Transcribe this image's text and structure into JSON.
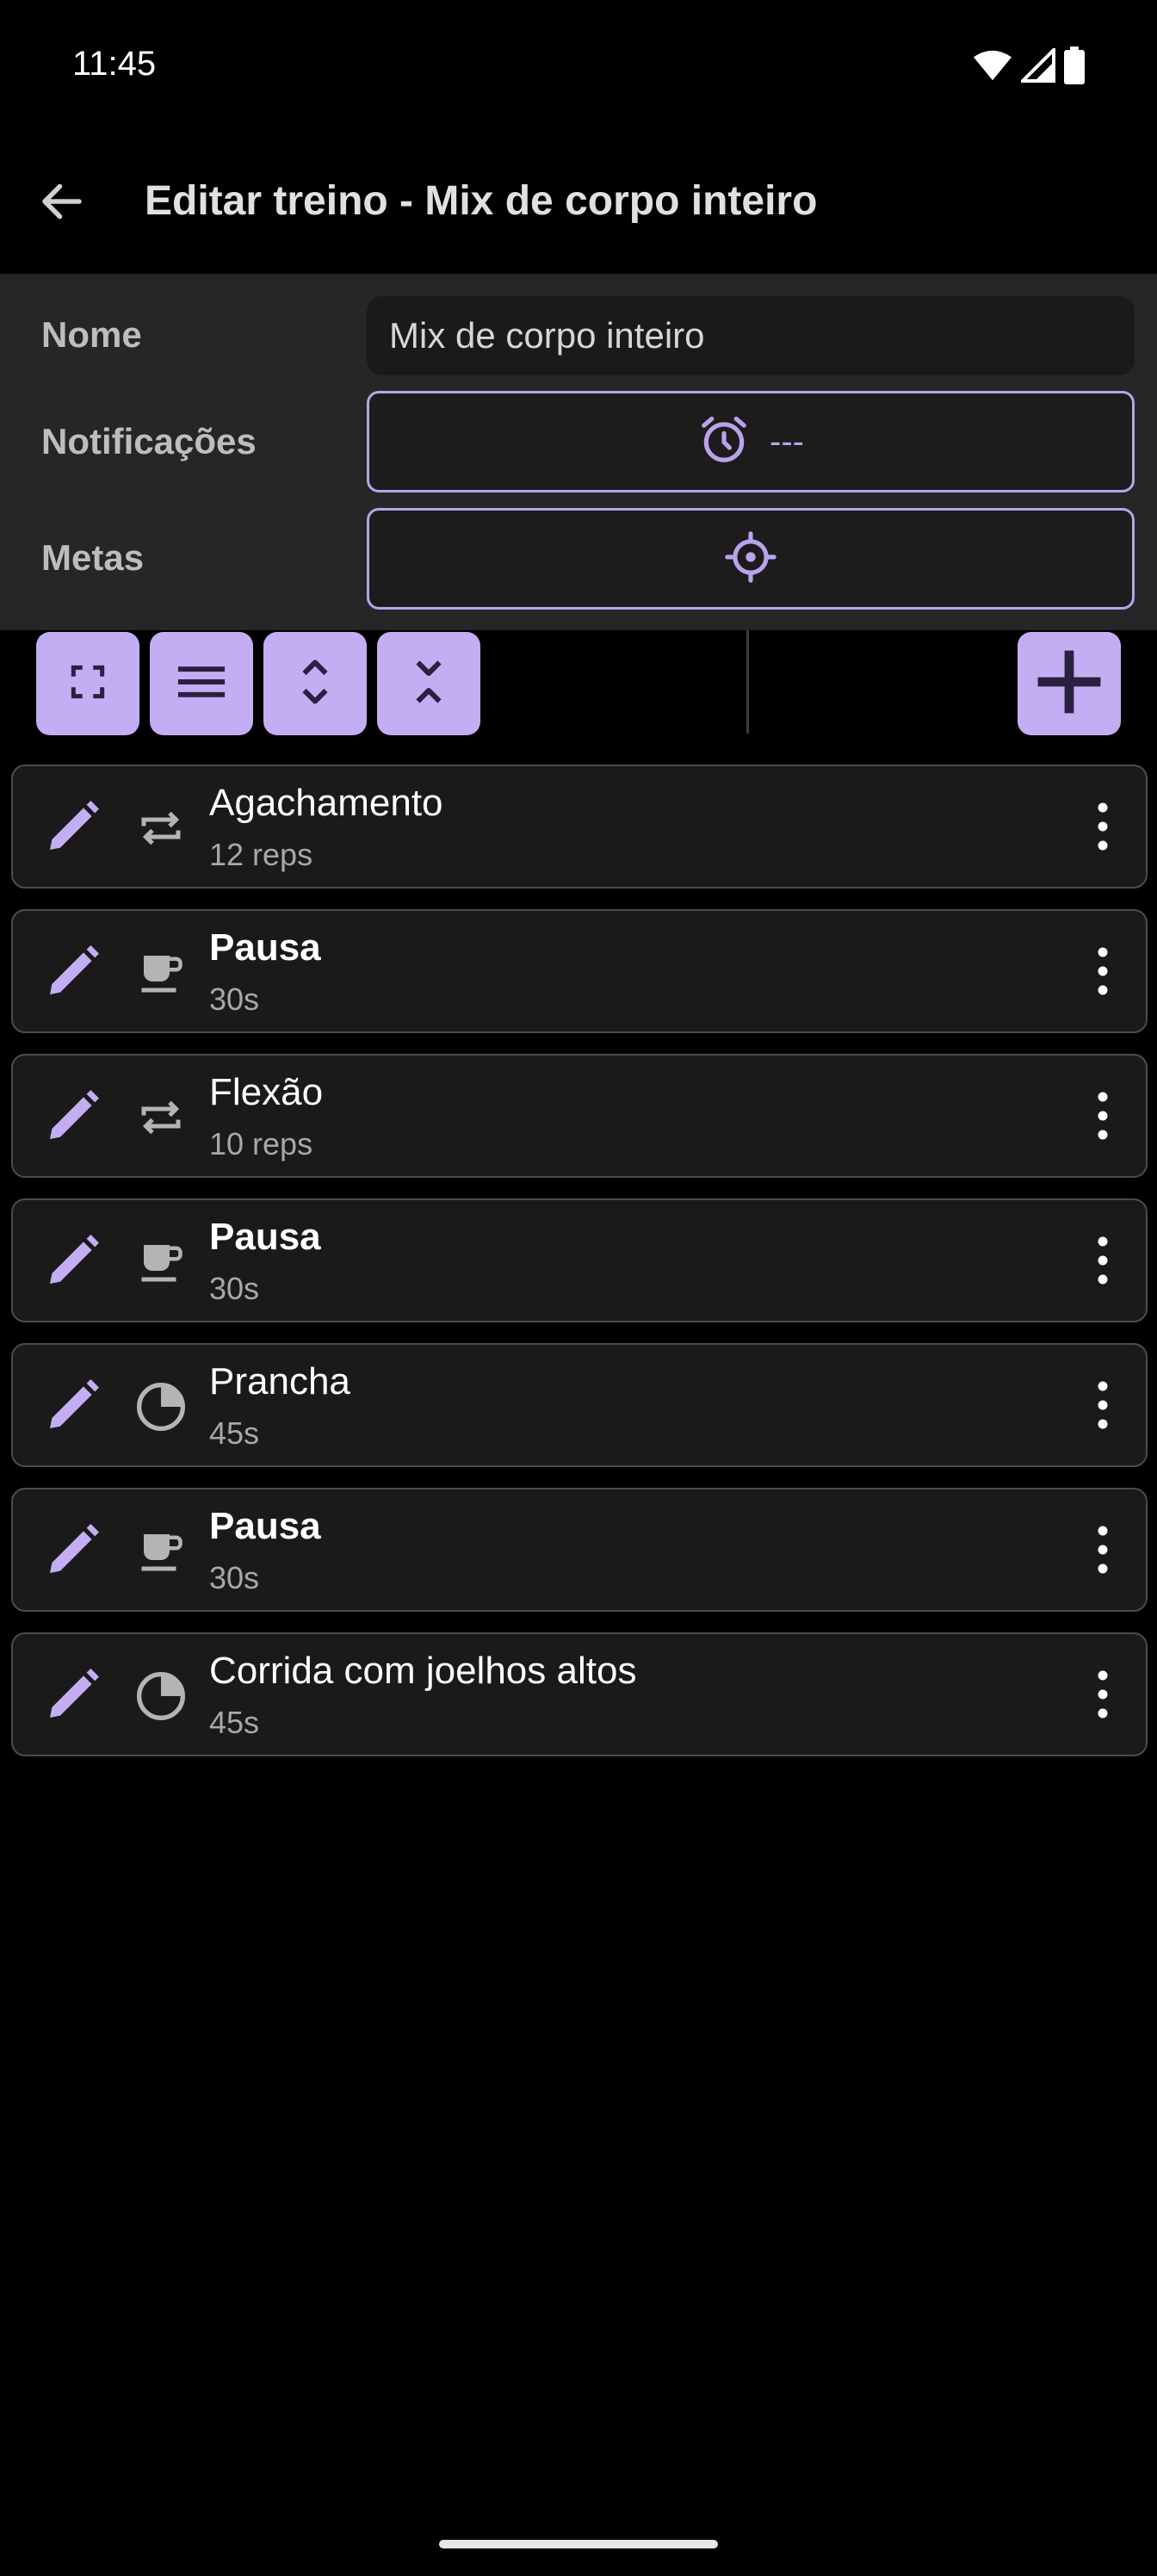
{
  "status_bar": {
    "time": "11:45",
    "icons": [
      "wifi-icon",
      "signal-icon",
      "battery-icon"
    ]
  },
  "app_bar": {
    "title": "Editar treino - Mix de corpo inteiro",
    "back_icon": "arrow-back-icon"
  },
  "form": {
    "name_label": "Nome",
    "name_value": "Mix de corpo inteiro",
    "notifications_label": "Notificações",
    "notifications_value": "---",
    "notifications_icon": "alarm-icon",
    "goals_label": "Metas",
    "goals_icon": "target-icon"
  },
  "toolbar": {
    "buttons": [
      "fullscreen-icon",
      "list-icon",
      "expand-icon",
      "collapse-icon"
    ],
    "add_icon": "add-icon"
  },
  "exercises": [
    {
      "name": "Agachamento",
      "detail": "12 reps",
      "type": "repeat-icon",
      "bold": false
    },
    {
      "name": "Pausa",
      "detail": "30s",
      "type": "coffee-icon",
      "bold": true
    },
    {
      "name": "Flexão",
      "detail": "10 reps",
      "type": "repeat-icon",
      "bold": false
    },
    {
      "name": "Pausa",
      "detail": "30s",
      "type": "coffee-icon",
      "bold": true
    },
    {
      "name": "Prancha",
      "detail": "45s",
      "type": "timer-icon",
      "bold": false
    },
    {
      "name": "Pausa",
      "detail": "30s",
      "type": "coffee-icon",
      "bold": true
    },
    {
      "name": "Corrida com joelhos altos",
      "detail": "45s",
      "type": "timer-icon",
      "bold": false
    }
  ],
  "colors": {
    "accent": "#c3aef4",
    "accent_outline": "#b9a3ea",
    "background": "#000000",
    "panel": "#262626",
    "card": "#1a1a1a",
    "icon_gray": "#b4b4b4"
  }
}
